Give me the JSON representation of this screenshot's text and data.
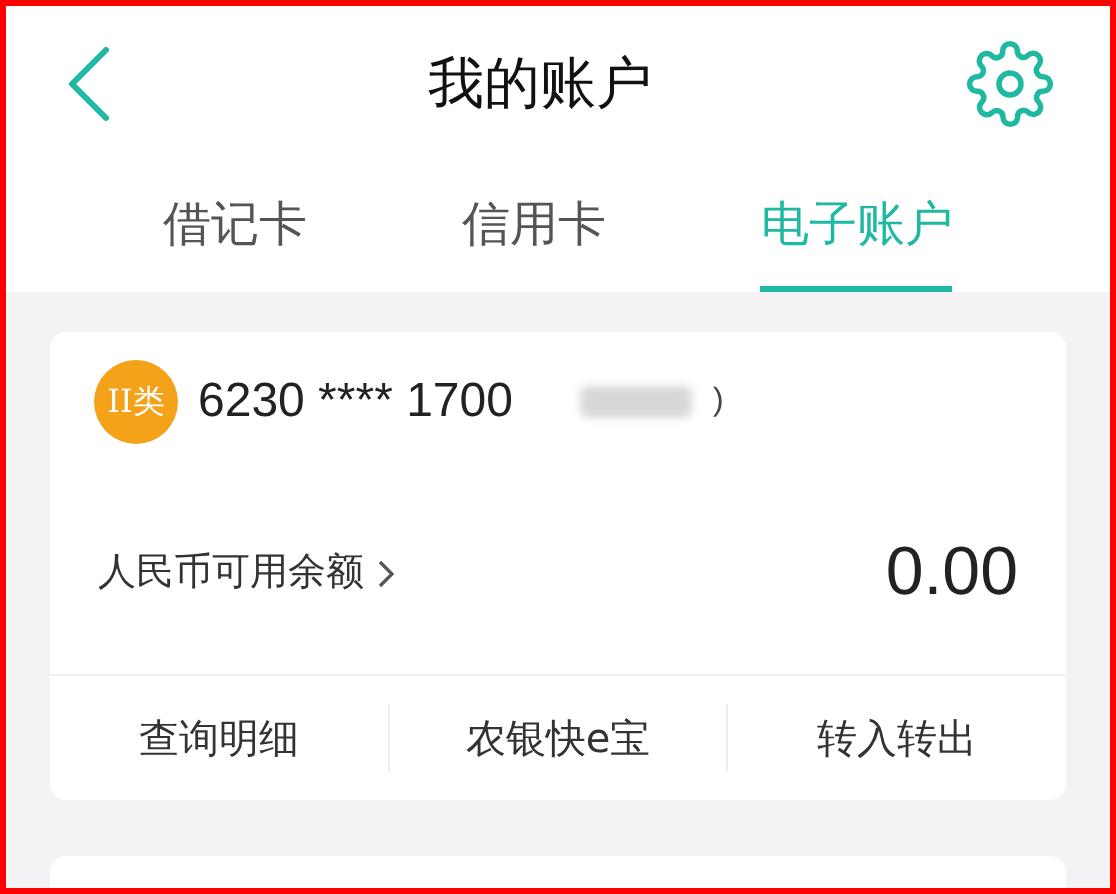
{
  "header": {
    "title": "我的账户"
  },
  "tabs": [
    {
      "label": "借记卡",
      "selected": false
    },
    {
      "label": "信用卡",
      "selected": false
    },
    {
      "label": "电子账户",
      "selected": true
    }
  ],
  "account_card": {
    "badge": "II类",
    "card_number": "6230 **** 1700",
    "masked_suffix": ")",
    "balance_label": "人民币可用余额",
    "balance": "0.00",
    "actions": [
      "查询明细",
      "农银快e宝",
      "转入转出"
    ]
  }
}
